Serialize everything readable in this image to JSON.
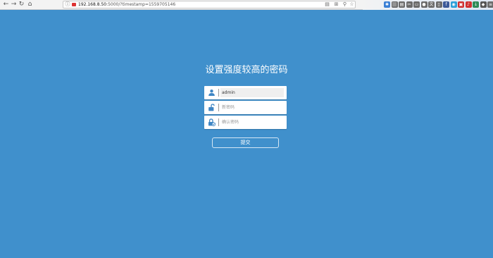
{
  "browser": {
    "back_icon": "arrow-left-icon",
    "forward_icon": "arrow-right-icon",
    "reload_icon": "reload-icon",
    "home_icon": "home-icon",
    "url_host": "192.168.8.50",
    "url_rest": ":5000/?timestamp=1559705146",
    "url_actions": [
      "reader-icon",
      "grid-icon",
      "search-icon",
      "star-icon"
    ],
    "extensions": [
      {
        "icon": "bluetooth-icon",
        "color": "#3a7fd5",
        "glyph": "✱"
      },
      {
        "icon": "library-icon",
        "color": "#6b6b6b",
        "glyph": "|||"
      },
      {
        "icon": "reader-view-icon",
        "color": "#6b6b6b",
        "glyph": "▤"
      },
      {
        "icon": "screenshot-icon",
        "color": "#6b6b6b",
        "glyph": "✂"
      },
      {
        "icon": "bookmark-icon",
        "color": "#6b6b6b",
        "glyph": "▭"
      },
      {
        "icon": "chat-icon",
        "color": "#6b6b6b",
        "glyph": "●"
      },
      {
        "icon": "translate-icon",
        "color": "#6b6b6b",
        "glyph": "文"
      },
      {
        "icon": "tag-icon",
        "color": "#6b6b6b",
        "glyph": "▯"
      },
      {
        "icon": "facebook-icon",
        "color": "#3b5998",
        "glyph": "f"
      },
      {
        "icon": "recorder-icon",
        "color": "#2a9fd8",
        "glyph": "◉"
      },
      {
        "icon": "picture-icon",
        "color": "#d03030",
        "glyph": "▣"
      },
      {
        "icon": "music-icon",
        "color": "#d03030",
        "glyph": "♪"
      },
      {
        "icon": "download-icon",
        "color": "#2e8b57",
        "glyph": "↓"
      },
      {
        "icon": "shield-icon",
        "color": "#555555",
        "glyph": "◆"
      },
      {
        "icon": "menu-icon",
        "color": "#6b6b6b",
        "glyph": "≡"
      }
    ]
  },
  "page": {
    "title": "设置强度较高的密码",
    "username": {
      "icon": "user-icon",
      "value": "admin"
    },
    "new_password": {
      "icon": "unlock-icon",
      "placeholder": "新密码"
    },
    "confirm_password": {
      "icon": "lock-check-icon",
      "placeholder": "确认密码"
    },
    "submit_label": "提交"
  },
  "colors": {
    "background": "#4090cc",
    "icon": "#3f86c4",
    "text": "#ffffff"
  }
}
